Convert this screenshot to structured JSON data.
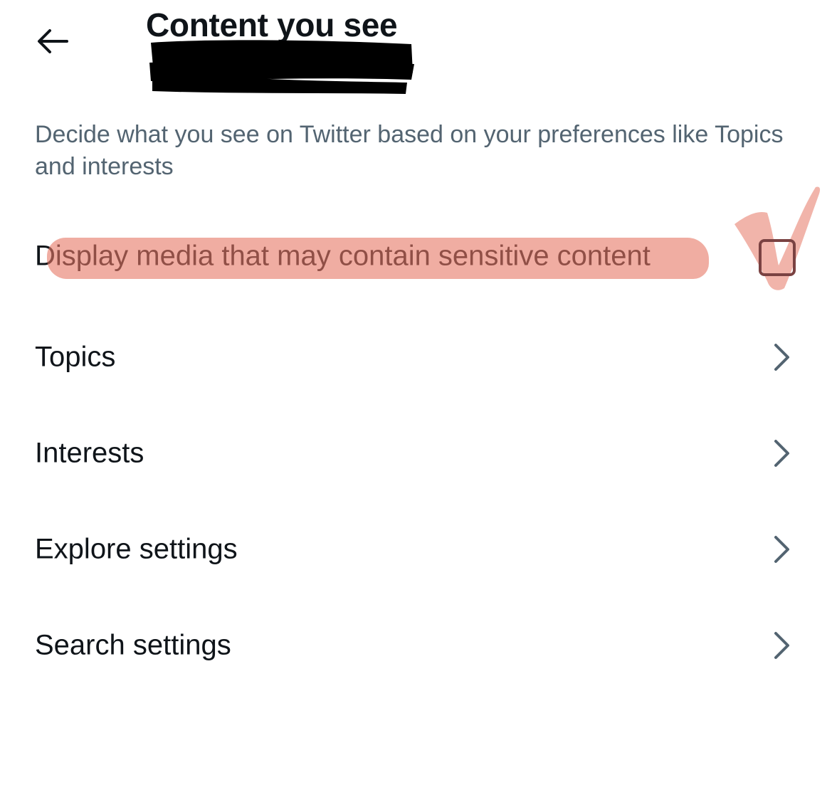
{
  "header": {
    "title": "Content you see",
    "back_icon": "arrow-left-icon"
  },
  "description": "Decide what you see on Twitter based on your preferences like Topics and interests",
  "settings": {
    "sensitive": {
      "label": "Display media that may contain sensitive content",
      "checked": false
    },
    "items": [
      {
        "label": "Topics",
        "icon": "chevron-right-icon"
      },
      {
        "label": "Interests",
        "icon": "chevron-right-icon"
      },
      {
        "label": "Explore settings",
        "icon": "chevron-right-icon"
      },
      {
        "label": "Search settings",
        "icon": "chevron-right-icon"
      }
    ]
  },
  "colors": {
    "text_primary": "#0f1419",
    "text_secondary": "#536471",
    "highlight_annotation": "#e67664",
    "redaction": "#000000"
  }
}
